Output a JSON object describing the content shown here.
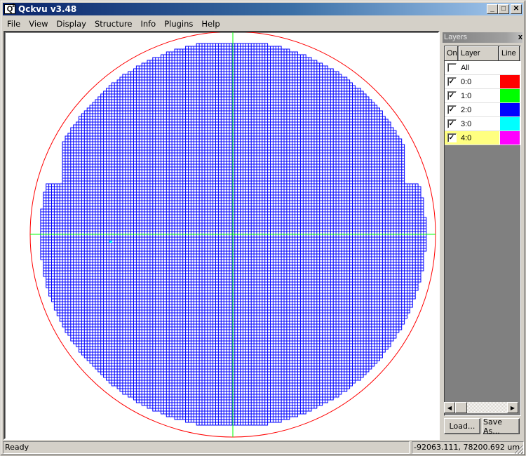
{
  "window": {
    "title": "Qckvu v3.48",
    "icon": "Q",
    "icon_superscript": "3",
    "buttons": {
      "minimize": "_",
      "maximize": "□",
      "close": "✕"
    }
  },
  "menu": [
    "File",
    "View",
    "Display",
    "Structure",
    "Info",
    "Plugins",
    "Help"
  ],
  "layers_panel": {
    "title": "Layers",
    "close": "x",
    "columns": {
      "on": "On",
      "layer": "Layer",
      "line": "Line"
    },
    "rows": [
      {
        "name": "All",
        "checked": false,
        "color": null,
        "selected": false
      },
      {
        "name": "0:0",
        "checked": true,
        "color": "#ff0000",
        "selected": false
      },
      {
        "name": "1:0",
        "checked": true,
        "color": "#00ff00",
        "selected": false
      },
      {
        "name": "2:0",
        "checked": true,
        "color": "#0000ff",
        "selected": false
      },
      {
        "name": "3:0",
        "checked": true,
        "color": "#00ffff",
        "selected": false
      },
      {
        "name": "4:0",
        "checked": true,
        "color": "#ff00ff",
        "selected": true
      }
    ],
    "load_button": "Load...",
    "save_button": "Save As..."
  },
  "canvas": {
    "wafer_outline_color": "#ff0000",
    "crosshair_color": "#00ff00",
    "die_color": "#0000ff",
    "highlight_die_color": "#00ffff"
  },
  "status": {
    "message": "Ready",
    "coordinates": "-92063.111, 78200.692 um"
  }
}
